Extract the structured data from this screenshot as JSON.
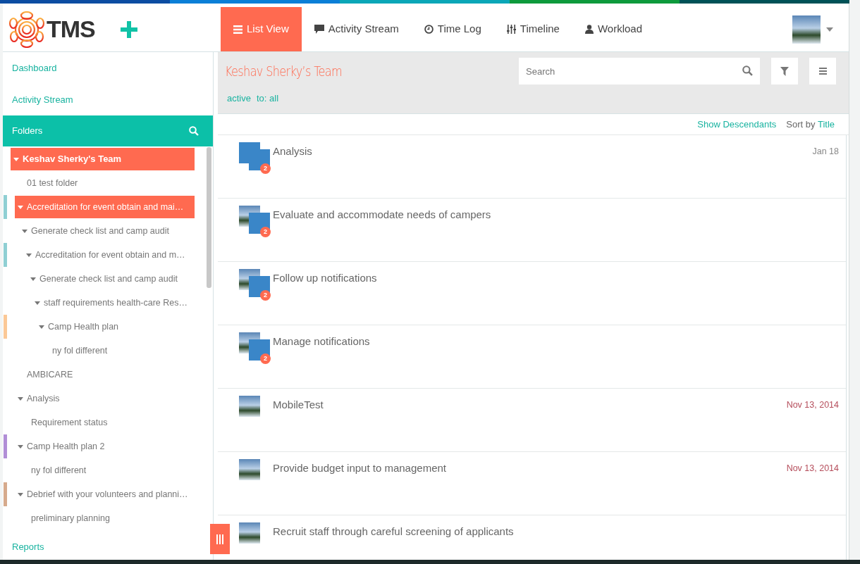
{
  "logo": {
    "text": "TMS"
  },
  "nav": {
    "tabs": [
      {
        "label": "List View",
        "selected": true
      },
      {
        "label": "Activity Stream",
        "selected": false
      },
      {
        "label": "Time Log",
        "selected": false
      },
      {
        "label": "Timeline",
        "selected": false
      },
      {
        "label": "Workload",
        "selected": false
      }
    ]
  },
  "sidebar": {
    "links": [
      {
        "label": "Dashboard"
      },
      {
        "label": "Activity Stream"
      }
    ],
    "folders": {
      "title": "Folders",
      "tree": [
        {
          "label": "Keshav Sherky's Team",
          "expanded": true,
          "selected": true,
          "children": [
            {
              "label": "01 test folder",
              "selected": false
            },
            {
              "label": "Accreditation for event obtain and mai…",
              "expanded": true,
              "selected": true,
              "color": "#8fcfd3",
              "children": [
                {
                  "label": "Generate check list and camp audit",
                  "expanded": true,
                  "selected": false,
                  "children": [
                    {
                      "label": "Accreditation for event obtain and m…",
                      "expanded": true,
                      "selected": false,
                      "color": "#8fcfd3",
                      "children": [
                        {
                          "label": "Generate check list and camp audit",
                          "expanded": true,
                          "selected": false,
                          "children": [
                            {
                              "label": "staff requirements health-care Res…",
                              "expanded": true,
                              "selected": false,
                              "children": [
                                {
                                  "label": "Camp Health plan",
                                  "expanded": true,
                                  "selected": false,
                                  "color": "#fbc896",
                                  "children": [
                                    {
                                      "label": "ny fol different",
                                      "selected": false
                                    }
                                  ]
                                }
                              ]
                            }
                          ]
                        }
                      ]
                    }
                  ]
                }
              ]
            },
            {
              "label": "AMBICARE",
              "selected": false
            },
            {
              "label": "Analysis",
              "expanded": true,
              "selected": false,
              "children": [
                {
                  "label": "Requirement status",
                  "selected": false
                }
              ]
            },
            {
              "label": "Camp Health plan 2",
              "expanded": true,
              "selected": false,
              "color": "#b18ed6",
              "children": [
                {
                  "label": "ny fol different",
                  "selected": false
                }
              ]
            },
            {
              "label": "Debrief with your volunteers and planni…",
              "expanded": true,
              "selected": false,
              "color": "#d6aa8c",
              "children": [
                {
                  "label": "preliminary planning",
                  "selected": false
                }
              ]
            }
          ]
        }
      ]
    },
    "footer_link": "Reports"
  },
  "main": {
    "title": "Keshav Sherky’s Team",
    "filters": [
      "active",
      "to: all"
    ],
    "search": {
      "placeholder": "Search"
    },
    "show_descendants": "Show Descendants",
    "sort": {
      "label": "Sort by",
      "value": "Title"
    },
    "tasks": [
      {
        "title": "Analysis",
        "date": "Jan 18",
        "overdue": false,
        "kind": "group",
        "count": "2"
      },
      {
        "title": "Evaluate and accommodate needs of campers",
        "kind": "group",
        "count": "2"
      },
      {
        "title": "Follow up notifications",
        "kind": "group",
        "count": "2"
      },
      {
        "title": "Manage notifications",
        "kind": "group",
        "count": "2"
      },
      {
        "title": "MobileTest",
        "date": "Nov 13, 2014",
        "overdue": true,
        "kind": "single"
      },
      {
        "title": "Provide budget input to management",
        "date": "Nov 13, 2014",
        "overdue": true,
        "kind": "single"
      },
      {
        "title": "Recruit staff through careful screening of applicants",
        "kind": "single"
      }
    ]
  }
}
